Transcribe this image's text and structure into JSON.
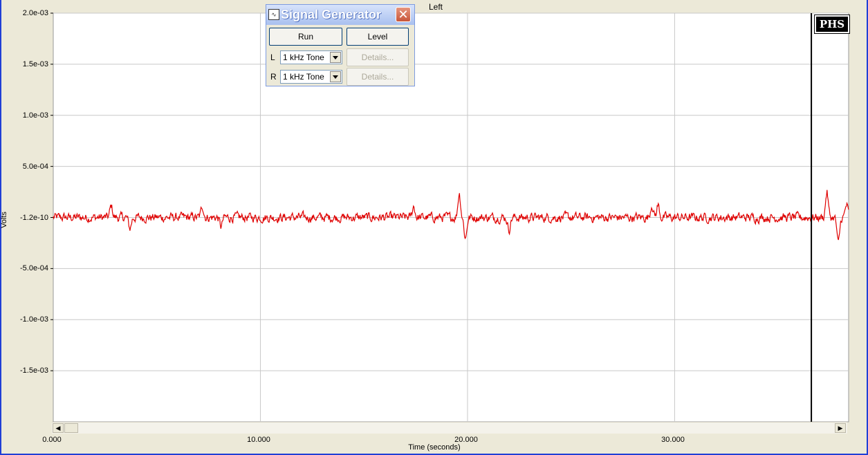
{
  "chart_data": {
    "type": "line",
    "title": "Left",
    "xlabel": "Time (seconds)",
    "ylabel": "Volts",
    "xlim": [
      0,
      38.4
    ],
    "ylim": [
      -0.002,
      0.002
    ],
    "x_ticks": [
      0,
      10,
      20,
      30
    ],
    "x_tick_labels": [
      "0.000",
      "10.000",
      "20.000",
      "30.000"
    ],
    "y_ticks": [
      0.002,
      0.0015,
      0.001,
      0.0005,
      0,
      -0.0005,
      -0.001,
      -0.0015
    ],
    "y_tick_labels": [
      "2.0e-03",
      "1.5e-03",
      "1.0e-03",
      "5.0e-04",
      "-1.2e-10",
      "-5.0e-04",
      "-1.0e-03",
      "-1.5e-03"
    ],
    "grid": true,
    "series": [
      {
        "color": "#e00000",
        "noise_amplitude": 6e-05,
        "spikes": [
          {
            "x": 2.8,
            "y": 0.00011
          },
          {
            "x": 3.7,
            "y": -0.00011
          },
          {
            "x": 7.2,
            "y": 0.00011
          },
          {
            "x": 8.1,
            "y": -9e-05
          },
          {
            "x": 17.4,
            "y": 0.00011
          },
          {
            "x": 19.6,
            "y": 0.00024
          },
          {
            "x": 19.9,
            "y": -0.0002
          },
          {
            "x": 22.0,
            "y": -0.00012
          },
          {
            "x": 28.9,
            "y": 0.00013
          },
          {
            "x": 29.2,
            "y": 0.00012
          },
          {
            "x": 37.35,
            "y": 0.00025
          },
          {
            "x": 37.9,
            "y": -0.00026
          },
          {
            "x": 38.3,
            "y": 0.00012
          }
        ]
      }
    ],
    "cursor_x": 36.6,
    "colors": {
      "grid": "#c8c8c8",
      "cursor": "#000000",
      "plot_bg": "#ffffff"
    }
  },
  "badge": {
    "text": "PHS"
  },
  "signal_generator": {
    "title": "Signal Generator",
    "close_glyph": "✕",
    "run_label": "Run",
    "level_label": "Level",
    "left_channel_label": "L",
    "right_channel_label": "R",
    "left_tone": "1 kHz Tone",
    "right_tone": "1 kHz Tone",
    "details_label": "Details...",
    "icon_name": "waveform-icon"
  },
  "scrollbar": {
    "left_arrow": "◀",
    "right_arrow": "▶"
  }
}
